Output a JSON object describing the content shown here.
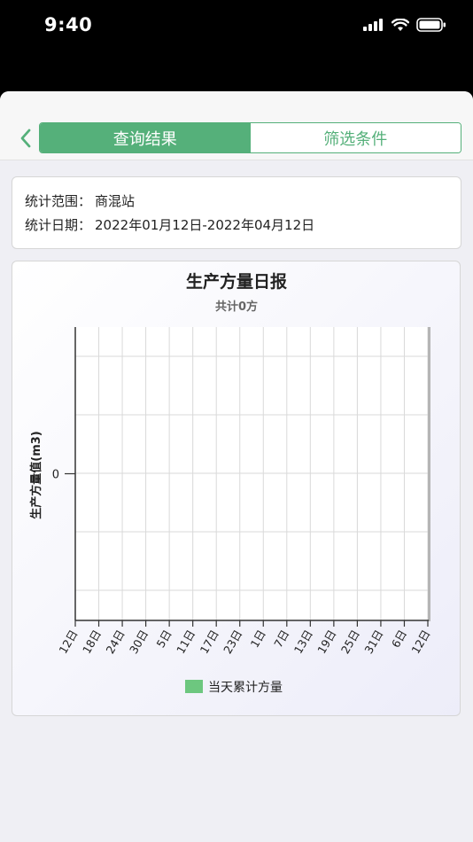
{
  "status_bar": {
    "time": "9:40",
    "icons": [
      "cellular-signal-icon",
      "wifi-icon",
      "battery-icon"
    ]
  },
  "nav": {
    "back_icon": "chevron-left-icon",
    "tabs": [
      {
        "label": "查询结果",
        "active": true
      },
      {
        "label": "筛选条件",
        "active": false
      }
    ]
  },
  "info": {
    "range_label": "统计范围：",
    "range_value": "商混站",
    "date_label": "统计日期：",
    "date_value": "2022年01月12日-2022年04月12日"
  },
  "colors": {
    "accent": "#55b07a",
    "series": "#6dc77f"
  },
  "chart_data": {
    "type": "bar",
    "title": "生产方量日报",
    "subtitle": "共计0方",
    "xlabel": "",
    "ylabel": "生产方量值(m3)",
    "categories": [
      "12日",
      "18日",
      "24日",
      "30日",
      "5日",
      "11日",
      "17日",
      "23日",
      "1日",
      "7日",
      "13日",
      "19日",
      "25日",
      "31日",
      "6日",
      "12日"
    ],
    "y_ticks": [
      "0"
    ],
    "series": [
      {
        "name": "当天累计方量",
        "values": [
          0,
          0,
          0,
          0,
          0,
          0,
          0,
          0,
          0,
          0,
          0,
          0,
          0,
          0,
          0,
          0
        ]
      }
    ],
    "grid": true,
    "legend": "bottom"
  }
}
